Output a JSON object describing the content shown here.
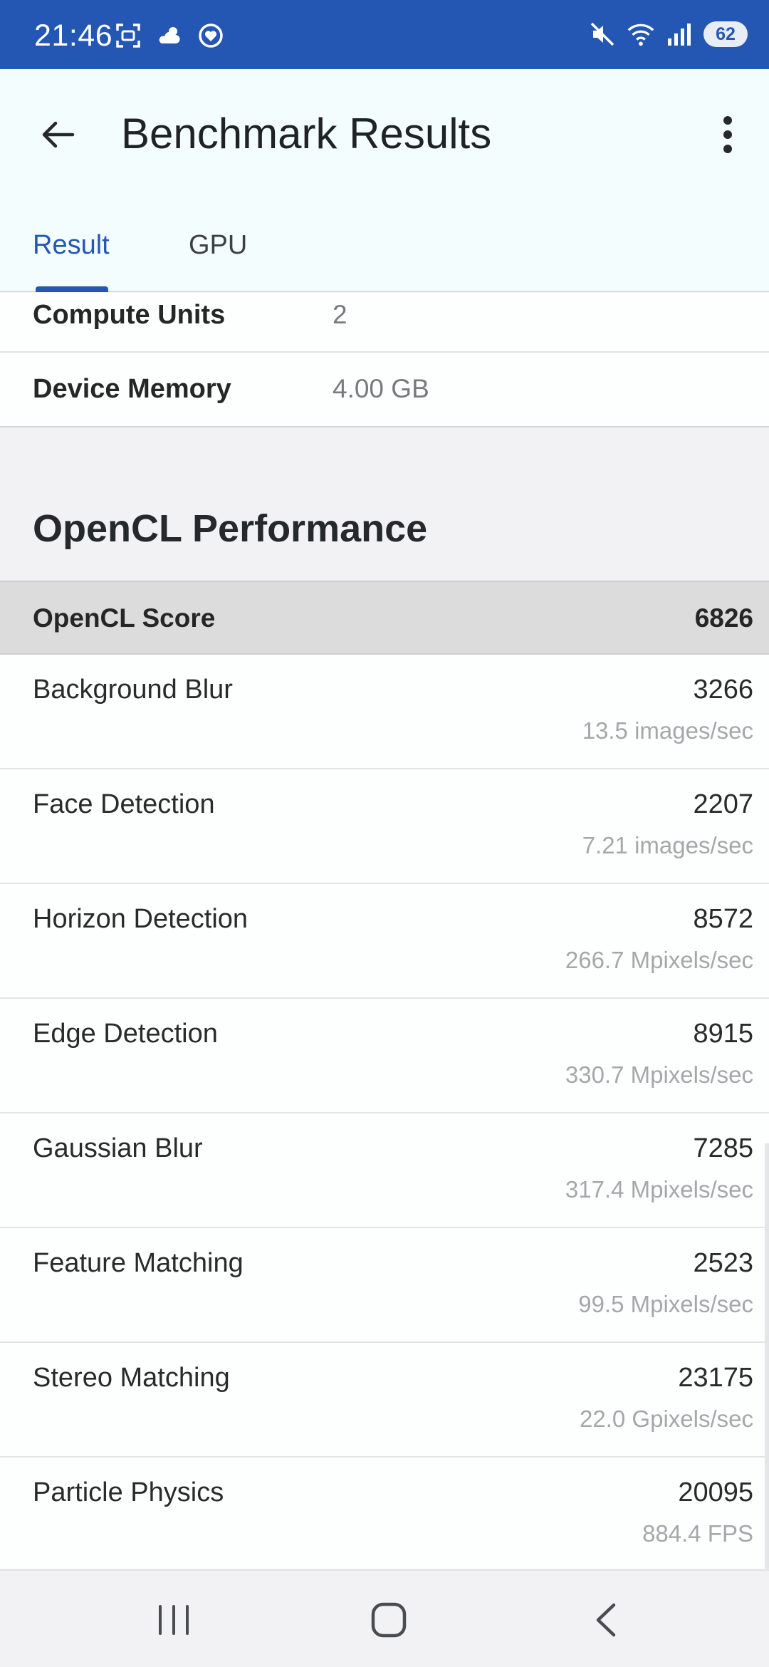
{
  "status_bar": {
    "time": "21:46",
    "battery": "62",
    "icons_left": [
      "screenshot-icon",
      "weather-icon",
      "health-icon"
    ],
    "icons_right": [
      "mute-icon",
      "wifi-icon",
      "signal-icon",
      "battery-icon"
    ]
  },
  "app_bar": {
    "title": "Benchmark Results",
    "tabs": [
      {
        "label": "Result",
        "selected": true
      },
      {
        "label": "GPU",
        "selected": false
      }
    ]
  },
  "gpu_info": [
    {
      "label": "Compute Units",
      "value": "2"
    },
    {
      "label": "Device Memory",
      "value": "4.00 GB"
    }
  ],
  "opencl": {
    "section_title": "OpenCL Performance",
    "score_label": "OpenCL Score",
    "score_value": "6826",
    "benchmarks": [
      {
        "name": "Background Blur",
        "score": "3266",
        "rate": "13.5 images/sec"
      },
      {
        "name": "Face Detection",
        "score": "2207",
        "rate": "7.21 images/sec"
      },
      {
        "name": "Horizon Detection",
        "score": "8572",
        "rate": "266.7 Mpixels/sec"
      },
      {
        "name": "Edge Detection",
        "score": "8915",
        "rate": "330.7 Mpixels/sec"
      },
      {
        "name": "Gaussian Blur",
        "score": "7285",
        "rate": "317.4 Mpixels/sec"
      },
      {
        "name": "Feature Matching",
        "score": "2523",
        "rate": "99.5 Mpixels/sec"
      },
      {
        "name": "Stereo Matching",
        "score": "23175",
        "rate": "22.0 Gpixels/sec"
      },
      {
        "name": "Particle Physics",
        "score": "20095",
        "rate": "884.4 FPS"
      }
    ]
  },
  "colors": {
    "status_bar": "#2456b3",
    "accent": "#2456b3",
    "app_bar_bg": "#f4fdfe",
    "score_row_bg": "#dcdcdc"
  },
  "nav_bar": {
    "buttons": [
      "recent-apps-icon",
      "home-icon",
      "back-icon"
    ]
  }
}
